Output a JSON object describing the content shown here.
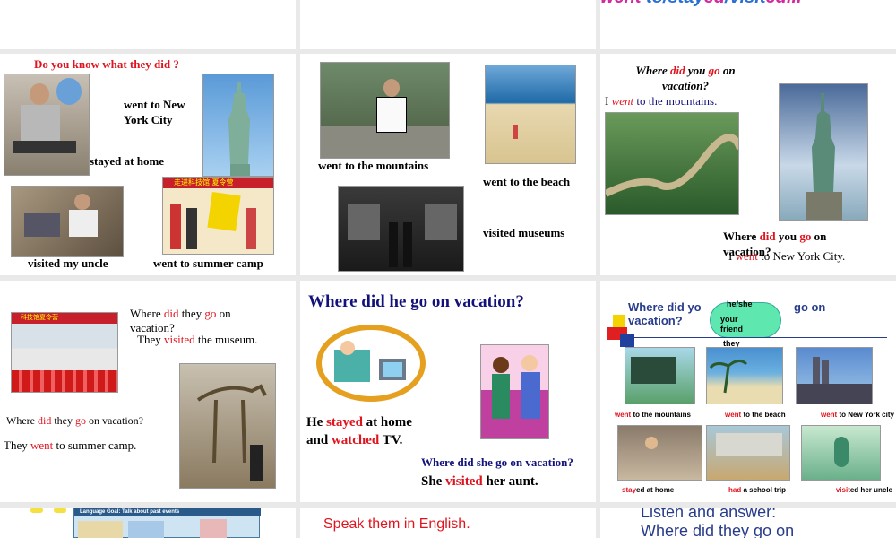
{
  "s3": {
    "title_went": "went",
    "title_to": " to/",
    "title_stay": "stay",
    "title_ed1": "ed",
    "title_slash": "/visit",
    "title_ed2": "ed..."
  },
  "s4": {
    "q": "Do you know what they did ?",
    "ny": "went to New York City",
    "home": "stayed at home",
    "uncle": "visited my uncle",
    "camp": "went to summer camp",
    "banner_text": "走进科技馆 夏令营"
  },
  "s5": {
    "mountains": "went to the mountains",
    "beach": "went to the beach",
    "museums": "visited museums"
  },
  "s6": {
    "q1a": "Where ",
    "q1did": "did",
    "q1b": " you ",
    "q1go": "go",
    "q1c": " on vacation?",
    "a1a": "I ",
    "a1went": "went",
    "a1b": " to the mountains.",
    "q2a": "Where ",
    "q2did": "did",
    "q2b": " you ",
    "q2go": "go",
    "q2c": " on vacation?",
    "a2a": "I ",
    "a2went": "went",
    "a2b": " to New York City."
  },
  "s7": {
    "q1a": "Where ",
    "q1did": "did",
    "q1b": " they ",
    "q1go": "go",
    "q1c": " on vacation?",
    "a1a": "They ",
    "a1v": "visited",
    "a1b": " the museum.",
    "q2a": "Where ",
    "q2did": "did",
    "q2b": " they ",
    "q2go": "go",
    "q2c": " on vacation?",
    "a2a": "They ",
    "a2w": "went",
    "a2b": " to summer camp.",
    "banner_text": "科技馆夏令营"
  },
  "s8": {
    "title": "Where did he go on vacation?",
    "a1a": "He ",
    "a1s": "stayed",
    "a1b": " at home",
    "a1c": "and ",
    "a1w": "watched",
    "a1d": " TV.",
    "q2": "Where did she go on vacation?",
    "a2a": "She ",
    "a2v": "visited",
    "a2b": " her aunt."
  },
  "s9": {
    "q_a": "Where did yo",
    "q_b": "go  on",
    "q_c": "vacation?",
    "bubble1": "he/she",
    "bubble2": "your friend",
    "bubble3": "they",
    "c1w": "went",
    "c1r": "  to  the mountains",
    "c2w": "went",
    "c2r": "  to  the  beach",
    "c3w": "went",
    "c3r": "  to  New York  city",
    "c4a": "stay",
    "c4ed": "ed",
    "c4r": " at  home",
    "c5h": "had",
    "c5r": "  a school  trip",
    "c6v": "visit",
    "c6ed": "ed",
    "c6r": "  her uncle"
  },
  "s10": {
    "lang_goal": "Language Goal: Talk about past events"
  },
  "s11": {
    "text": "Speak them in English."
  },
  "s12": {
    "line1": "Listen and answer:",
    "line2": "Where did they go on"
  }
}
